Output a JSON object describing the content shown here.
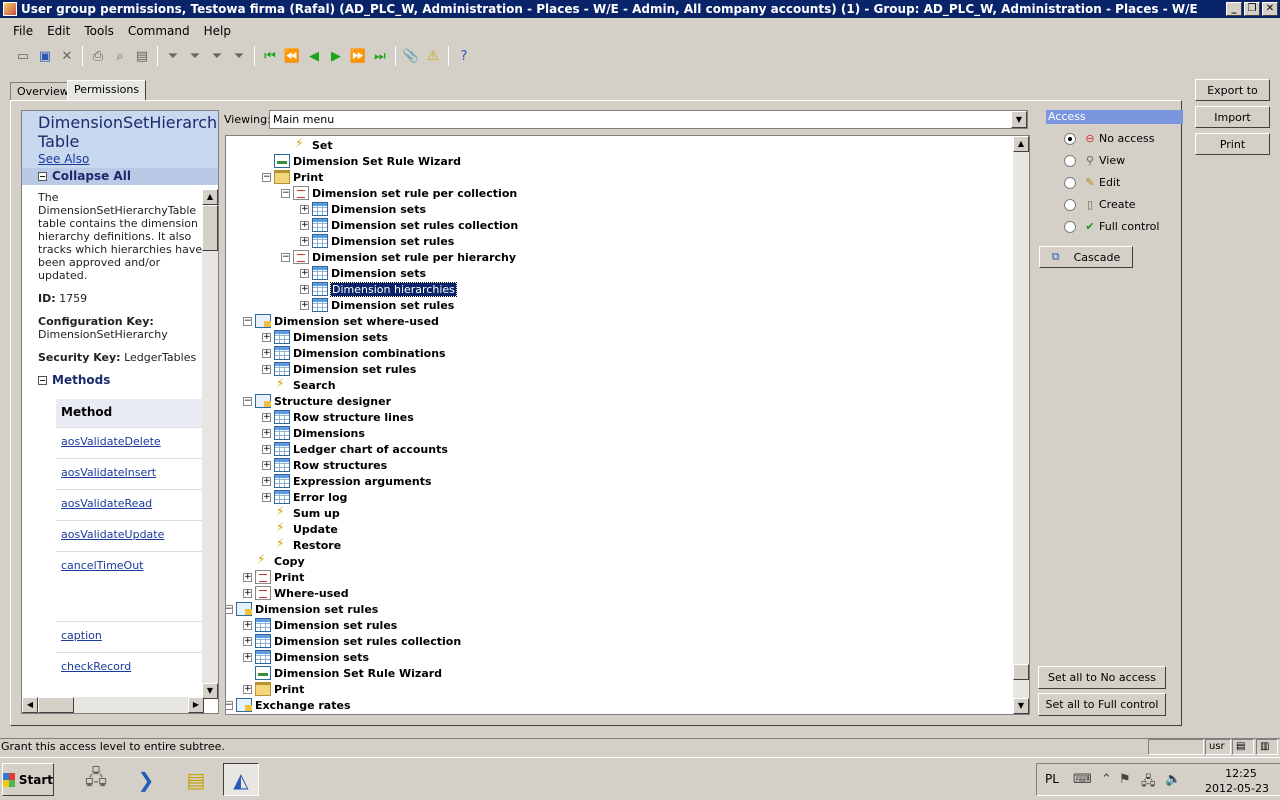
{
  "window": {
    "title": "User group permissions, Testowa firma (Rafal) (AD_PLC_W, Administration - Places - W/E - Admin, All company accounts) (1) - Group: AD_PLC_W, Administration - Places - W/E",
    "minimize": "_",
    "restore": "❐",
    "close": "✕"
  },
  "menu": [
    "File",
    "Edit",
    "Tools",
    "Command",
    "Help"
  ],
  "toolbar": {
    "icons": [
      "new-icon",
      "save-icon",
      "delete-icon",
      "print-icon",
      "print-preview-icon",
      "print-setup-icon",
      "filter-icon",
      "filter-by-selection-icon",
      "advanced-filter-icon",
      "remove-filter-icon",
      "first-record-icon",
      "previous-page-icon",
      "previous-record-icon",
      "next-record-icon",
      "next-page-icon",
      "last-record-icon",
      "document-handling-icon",
      "alert-icon",
      "help-icon"
    ]
  },
  "tabs": {
    "overview": "Overview",
    "permissions": "Permissions"
  },
  "help": {
    "title_line1": "DimensionSetHierarch",
    "title_line2": "Table",
    "see_also": "See Also",
    "collapse_all": "Collapse All",
    "description": [
      "The",
      "DimensionSetHierarchyTable",
      "table contains the dimension",
      "hierarchy definitions. It also",
      "tracks which hierarchies have",
      "been approved and/or",
      "updated."
    ],
    "id_label": "ID:",
    "id_value": "1759",
    "config_key_label": "Configuration Key:",
    "config_key_value": "DimensionSetHierarchy",
    "security_key_label": "Security Key:",
    "security_key_value": "LedgerTables",
    "methods_label": "Methods",
    "method_column": "Method",
    "methods": [
      "aosValidateDelete",
      "aosValidateInsert",
      "aosValidateRead",
      "aosValidateUpdate",
      "cancelTimeOut",
      "caption",
      "checkRecord"
    ]
  },
  "viewing": {
    "label": "Viewing:",
    "value": "Main menu"
  },
  "tree": [
    {
      "label": "Set",
      "icon": "action",
      "exp": "none"
    },
    {
      "label": "Dimension Set Rule Wizard",
      "icon": "wizard",
      "exp": "none"
    },
    {
      "label": "Print",
      "icon": "folder",
      "exp": "-"
    },
    {
      "label": "Dimension set rule per collection",
      "icon": "report",
      "exp": "-"
    },
    {
      "label": "Dimension sets",
      "icon": "table",
      "exp": "+"
    },
    {
      "label": "Dimension set rules collection",
      "icon": "table",
      "exp": "+"
    },
    {
      "label": "Dimension set rules",
      "icon": "table",
      "exp": "+"
    },
    {
      "label": "Dimension set rule per hierarchy",
      "icon": "report",
      "exp": "-"
    },
    {
      "label": "Dimension sets",
      "icon": "table",
      "exp": "+"
    },
    {
      "label": "Dimension hierarchies",
      "icon": "table",
      "exp": "+",
      "selected": true
    },
    {
      "label": "Dimension set rules",
      "icon": "table",
      "exp": "+"
    },
    {
      "label": "Dimension set where-used",
      "icon": "form",
      "exp": "-"
    },
    {
      "label": "Dimension sets",
      "icon": "table",
      "exp": "+"
    },
    {
      "label": "Dimension combinations",
      "icon": "table",
      "exp": "+"
    },
    {
      "label": "Dimension set rules",
      "icon": "table",
      "exp": "+"
    },
    {
      "label": "Search",
      "icon": "action",
      "exp": "none"
    },
    {
      "label": "Structure designer",
      "icon": "form",
      "exp": "-"
    },
    {
      "label": "Row structure lines",
      "icon": "table",
      "exp": "+"
    },
    {
      "label": "Dimensions",
      "icon": "table",
      "exp": "+"
    },
    {
      "label": "Ledger chart of accounts",
      "icon": "table",
      "exp": "+"
    },
    {
      "label": "Row structures",
      "icon": "table",
      "exp": "+"
    },
    {
      "label": "Expression arguments",
      "icon": "table",
      "exp": "+"
    },
    {
      "label": "Error log",
      "icon": "table",
      "exp": "+"
    },
    {
      "label": "Sum up",
      "icon": "action",
      "exp": "none"
    },
    {
      "label": "Update",
      "icon": "action",
      "exp": "none"
    },
    {
      "label": "Restore",
      "icon": "action",
      "exp": "none"
    },
    {
      "label": "Copy",
      "icon": "action",
      "exp": "none"
    },
    {
      "label": "Print",
      "icon": "report",
      "exp": "+"
    },
    {
      "label": "Where-used",
      "icon": "report",
      "exp": "+"
    },
    {
      "label": "Dimension set rules",
      "icon": "form",
      "exp": "-"
    },
    {
      "label": "Dimension set rules",
      "icon": "table",
      "exp": "+"
    },
    {
      "label": "Dimension set rules collection",
      "icon": "table",
      "exp": "+"
    },
    {
      "label": "Dimension sets",
      "icon": "table",
      "exp": "+"
    },
    {
      "label": "Dimension Set Rule Wizard",
      "icon": "wizard",
      "exp": "none"
    },
    {
      "label": "Print",
      "icon": "folder",
      "exp": "+"
    },
    {
      "label": "Exchange rates",
      "icon": "form",
      "exp": "-"
    }
  ],
  "access": {
    "label": "Access",
    "options": [
      {
        "label": "No access",
        "icon": "no-access-icon",
        "checked": true
      },
      {
        "label": "View",
        "icon": "view-icon",
        "checked": false
      },
      {
        "label": "Edit",
        "icon": "edit-icon",
        "checked": false
      },
      {
        "label": "Create",
        "icon": "create-icon",
        "checked": false
      },
      {
        "label": "Full control",
        "icon": "full-control-icon",
        "checked": false
      }
    ],
    "cascade": "Cascade",
    "set_no_access": "Set all to No access",
    "set_full_control": "Set all to Full control"
  },
  "side_buttons": {
    "export": "Export to",
    "import": "Import",
    "print": "Print"
  },
  "status": {
    "text": "Grant this access level to entire subtree.",
    "user": "usr"
  },
  "taskbar": {
    "start": "Start",
    "lang": "PL",
    "time": "12:25",
    "date": "2012-05-23"
  }
}
